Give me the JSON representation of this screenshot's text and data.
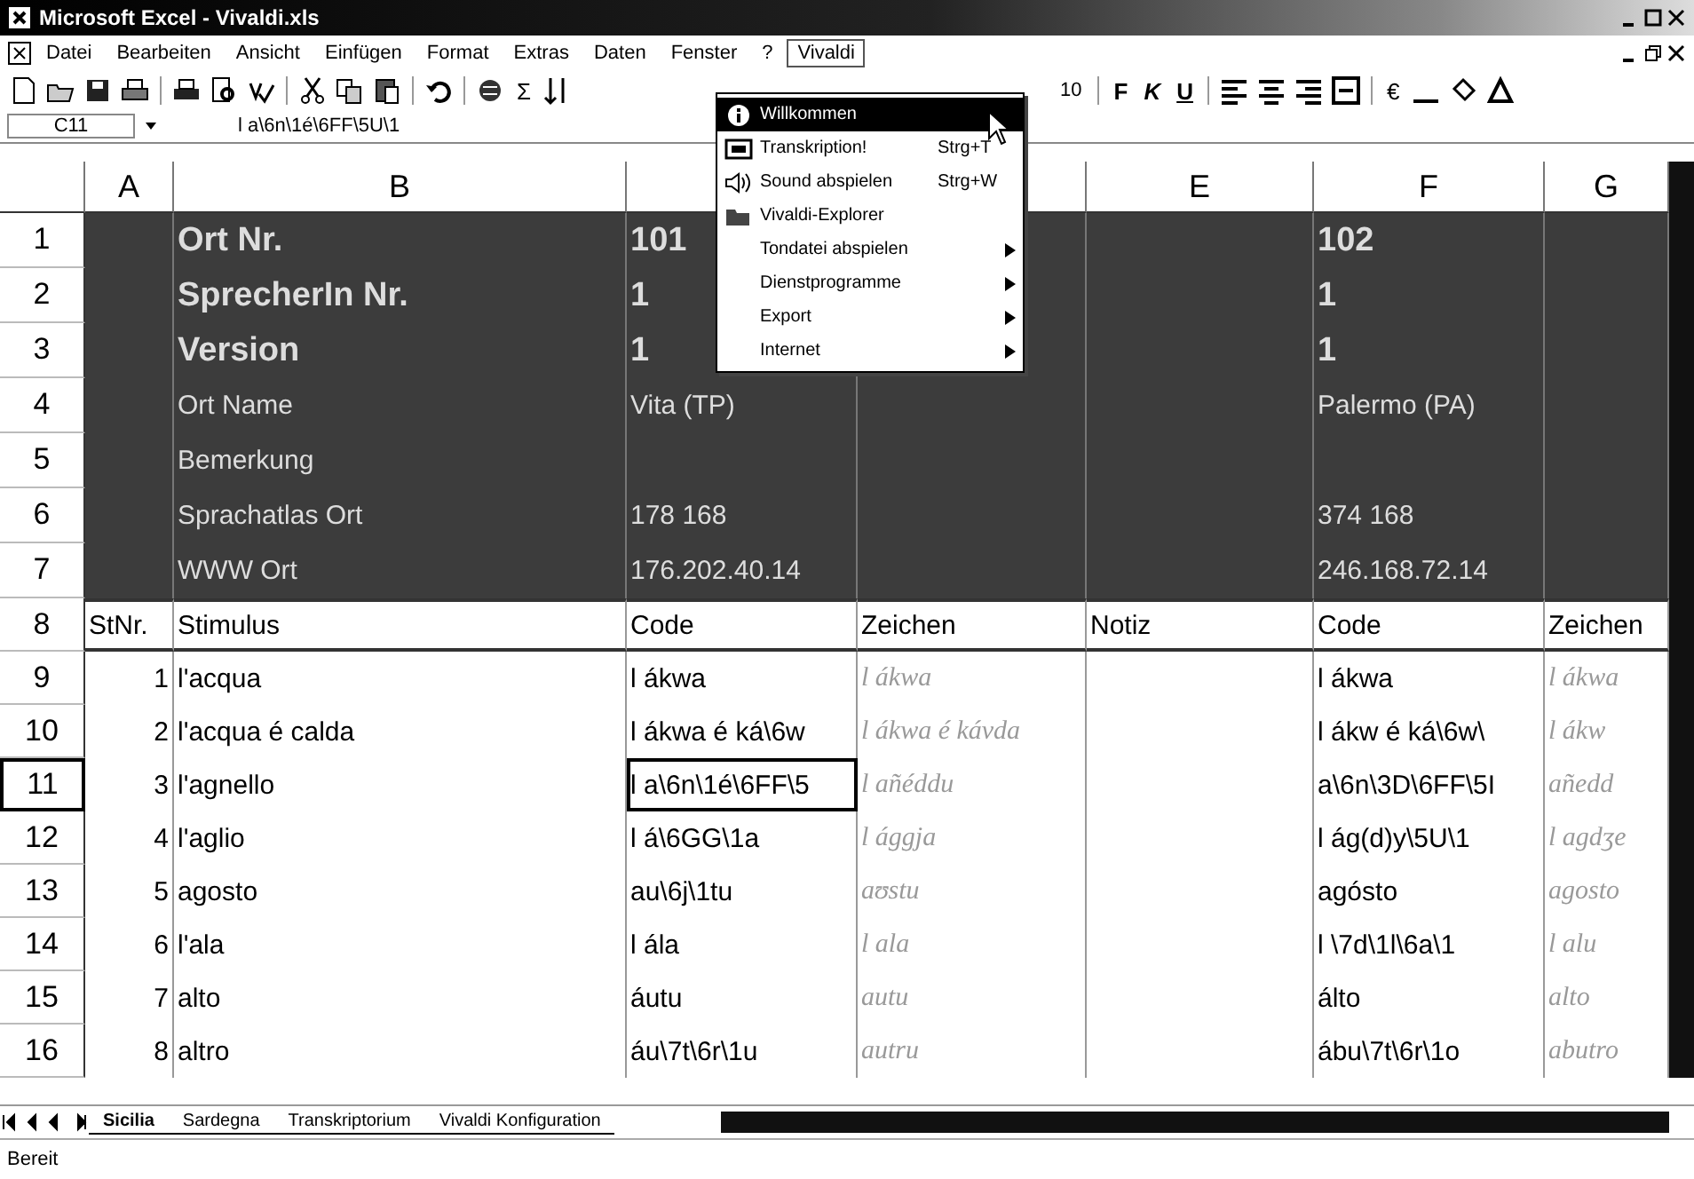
{
  "window": {
    "title": "Microsoft Excel - Vivaldi.xls"
  },
  "menu_bar": {
    "items": [
      {
        "label": "Datei",
        "selected": false
      },
      {
        "label": "Bearbeiten",
        "selected": false
      },
      {
        "label": "Ansicht",
        "selected": false
      },
      {
        "label": "Einfügen",
        "selected": false
      },
      {
        "label": "Format",
        "selected": false
      },
      {
        "label": "Extras",
        "selected": false
      },
      {
        "label": "Daten",
        "selected": false
      },
      {
        "label": "Fenster",
        "selected": false
      },
      {
        "label": "?",
        "selected": false
      },
      {
        "label": "Vivaldi",
        "selected": true
      }
    ]
  },
  "toolbar": {
    "sum_symbol": "Σ",
    "font_size": "10",
    "format_buttons": [
      "F",
      "K",
      "U"
    ],
    "currency": "€"
  },
  "formula_bar": {
    "name_box": "C11",
    "formula": "l a\\6n\\1é\\6FF\\5U\\1"
  },
  "dropdown_menu": {
    "items": [
      {
        "label": "Willkommen",
        "kind": "info",
        "submenu": false,
        "selected": true
      },
      {
        "label": "Transkription!",
        "shortcut": "Strg+T",
        "kind": "window",
        "submenu": false,
        "selected": false
      },
      {
        "label": "Sound abspielen",
        "shortcut": "Strg+W",
        "kind": "sound",
        "submenu": false,
        "selected": false
      },
      {
        "label": "Vivaldi-Explorer",
        "kind": "folder",
        "submenu": false,
        "selected": false
      },
      {
        "label": "Tondatei abspielen",
        "kind": "none",
        "submenu": true,
        "selected": false
      },
      {
        "label": "Dienstprogramme",
        "kind": "none",
        "submenu": true,
        "selected": false
      },
      {
        "label": "Export",
        "kind": "none",
        "submenu": true,
        "selected": false
      },
      {
        "label": "Internet",
        "kind": "none",
        "submenu": true,
        "selected": false
      }
    ]
  },
  "sheet": {
    "columns": [
      {
        "label": "A"
      },
      {
        "label": "B"
      },
      {},
      {},
      {
        "label": "E"
      },
      {
        "label": "F"
      },
      {
        "label": "G"
      }
    ],
    "rows": [
      {
        "header": "1",
        "kind": "title",
        "selected": false,
        "b": "Ort Nr.",
        "c": "101",
        "f": "102"
      },
      {
        "header": "2",
        "kind": "title",
        "selected": false,
        "b": "SprecherIn Nr.",
        "c": "1",
        "f": "1"
      },
      {
        "header": "3",
        "kind": "title",
        "selected": false,
        "b": "Version",
        "c": "1",
        "f": "1"
      },
      {
        "header": "4",
        "kind": "info",
        "selected": false,
        "b": "Ort Name",
        "c": "Vita (TP)",
        "f": "Palermo (PA)"
      },
      {
        "header": "5",
        "kind": "info",
        "selected": false,
        "b": "Bemerkung"
      },
      {
        "header": "6",
        "kind": "info",
        "selected": false,
        "b": "Sprachatlas Ort",
        "c": "178 168",
        "f": "374 168"
      },
      {
        "header": "7",
        "kind": "info",
        "selected": false,
        "b": "WWW Ort",
        "c": "176.202.40.14",
        "f": "246.168.72.14"
      },
      {
        "header": "8",
        "kind": "heading",
        "selected": false,
        "a": "StNr.",
        "b": "Stimulus",
        "c": "Code",
        "d": "Zeichen",
        "e": "Notiz",
        "f": "Code",
        "g": "Zeichen"
      },
      {
        "header": "9",
        "kind": "data",
        "selected": false,
        "a": "1",
        "b": "l'acqua",
        "c": "l ákwa",
        "d": "l ákwa",
        "f": "l ákwa",
        "g": "l ákwa"
      },
      {
        "header": "10",
        "kind": "data",
        "selected": false,
        "a": "2",
        "b": "l'acqua é calda",
        "c": "l ákwa é ká\\6w",
        "d": "l ákwa é kávda",
        "f": "l ákw é ká\\6w\\",
        "g": "l ákw"
      },
      {
        "header": "11",
        "kind": "data",
        "selected": true,
        "a": "3",
        "b": "l'agnello",
        "c": "l a\\6n\\1é\\6FF\\5",
        "d": "l añéddu",
        "f": "a\\6n\\3D\\6FF\\5I",
        "g": "añedd"
      },
      {
        "header": "12",
        "kind": "data",
        "selected": false,
        "a": "4",
        "b": "l'aglio",
        "c": "l á\\6GG\\1a",
        "d": "l ággja",
        "f": "l ág(d)y\\5U\\1",
        "g": "l agdʒe"
      },
      {
        "header": "13",
        "kind": "data",
        "selected": false,
        "a": "5",
        "b": "agosto",
        "c": "au\\6j\\1tu",
        "d": "aʊstu",
        "f": "agósto",
        "g": "agosto"
      },
      {
        "header": "14",
        "kind": "data",
        "selected": false,
        "a": "6",
        "b": "l'ala",
        "c": "l ála",
        "d": "l ala",
        "f": "l \\7d\\1l\\6a\\1",
        "g": "l alu"
      },
      {
        "header": "15",
        "kind": "data",
        "selected": false,
        "a": "7",
        "b": "alto",
        "c": "áutu",
        "d": "autu",
        "f": "álto",
        "g": "alto"
      },
      {
        "header": "16",
        "kind": "data",
        "selected": false,
        "a": "8",
        "b": "altro",
        "c": "áu\\7t\\6r\\1u",
        "d": "autru",
        "f": "ábu\\7t\\6r\\1o",
        "g": "abutro"
      }
    ]
  },
  "sheet_tabs": [
    {
      "label": "Sicilia",
      "selected": true
    },
    {
      "label": "Sardegna",
      "selected": false
    },
    {
      "label": "Transkriptorium",
      "selected": false
    },
    {
      "label": "Vivaldi Konfiguration",
      "selected": false
    }
  ],
  "status_bar": {
    "text": "Bereit"
  }
}
